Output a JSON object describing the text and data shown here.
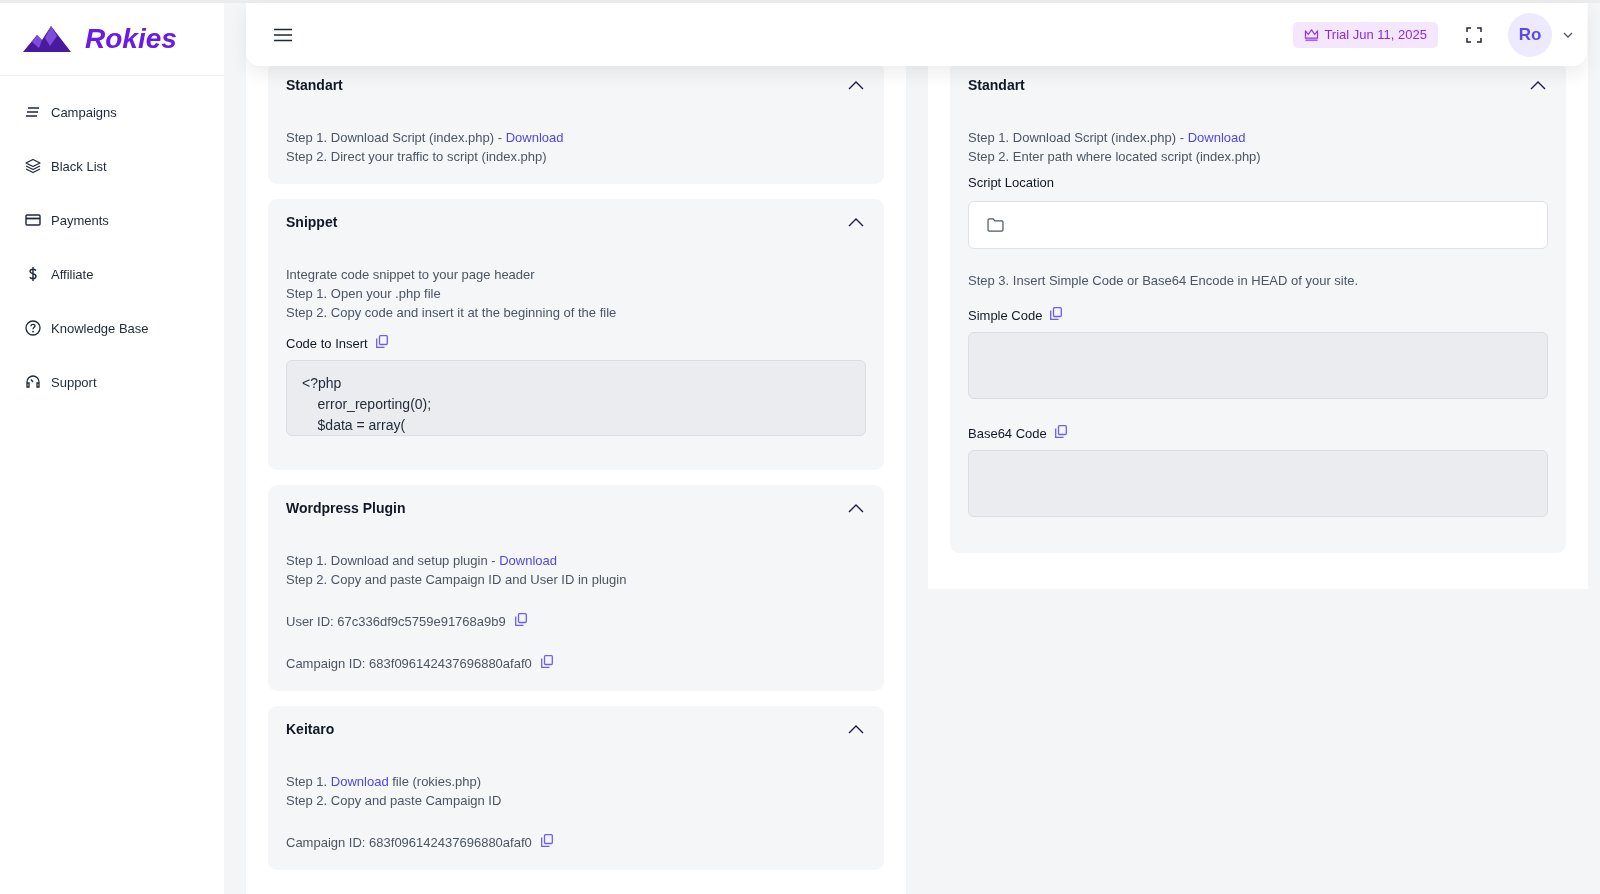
{
  "brand": {
    "name": "Rokies"
  },
  "sidebar": {
    "items": [
      {
        "label": "Campaigns",
        "selected": false
      },
      {
        "label": "Black List",
        "selected": false
      },
      {
        "label": "Payments",
        "selected": false
      },
      {
        "label": "Affiliate",
        "selected": false
      },
      {
        "label": "Knowledge Base",
        "selected": false
      },
      {
        "label": "Support",
        "selected": false
      }
    ]
  },
  "header": {
    "trial_badge": "Trial Jun 11, 2025",
    "avatar": "Ro"
  },
  "left_sections": [
    {
      "title": "Standart",
      "expanded": true,
      "blocks": [
        {
          "kind": "steps",
          "lines": [
            {
              "text": "Step 1. Download Script (index.php) - ",
              "link": "Download"
            },
            {
              "text": "Step 2. Direct your traffic to script (index.php)"
            }
          ]
        }
      ]
    },
    {
      "title": "Snippet",
      "expanded": true,
      "blocks": [
        {
          "kind": "steps",
          "lines": [
            {
              "text": "Integrate code snippet to your page header"
            },
            {
              "text": "Step 1. Open your .php file"
            },
            {
              "text": "Step 2. Copy code and insert it at the beginning of the file"
            }
          ]
        },
        {
          "kind": "code",
          "label": "Code to Insert",
          "value": "<?php\n    error_reporting(0);\n    $data = array("
        }
      ]
    },
    {
      "title": "Wordpress Plugin",
      "expanded": true,
      "blocks": [
        {
          "kind": "steps",
          "lines": [
            {
              "text": "Step 1. Download and setup plugin - ",
              "link": "Download"
            },
            {
              "text": "Step 2. Copy and paste Campaign ID and User ID in plugin"
            }
          ]
        },
        {
          "kind": "id",
          "text": "User ID: 67c336df9c5759e91768a9b9"
        },
        {
          "kind": "id",
          "text": "Campaign ID: 683f096142437696880afaf0"
        }
      ]
    },
    {
      "title": "Keitaro",
      "expanded": true,
      "blocks": [
        {
          "kind": "steps",
          "lines": [
            {
              "text": "Step 1. ",
              "link": "Download",
              "after": " file (rokies.php)"
            },
            {
              "text": "Step 2. Copy and paste Campaign ID"
            }
          ]
        },
        {
          "kind": "id",
          "text": "Campaign ID: 683f096142437696880afaf0"
        }
      ]
    }
  ],
  "right_sections": [
    {
      "title": "Standart",
      "expanded": true,
      "blocks": [
        {
          "kind": "steps",
          "lines": [
            {
              "text": "Step 1. Download Script (index.php) - ",
              "link": "Download"
            },
            {
              "text": "Step 2. Enter path where located script (index.php)"
            }
          ]
        },
        {
          "kind": "location",
          "label": "Script Location"
        },
        {
          "kind": "steps",
          "lines": [
            {
              "text": "Step 3. Insert Simple Code or Base64 Encode in HEAD of your site."
            }
          ]
        },
        {
          "kind": "code",
          "label": "Simple Code"
        },
        {
          "kind": "code",
          "label": "Base64 Code"
        }
      ]
    }
  ]
}
